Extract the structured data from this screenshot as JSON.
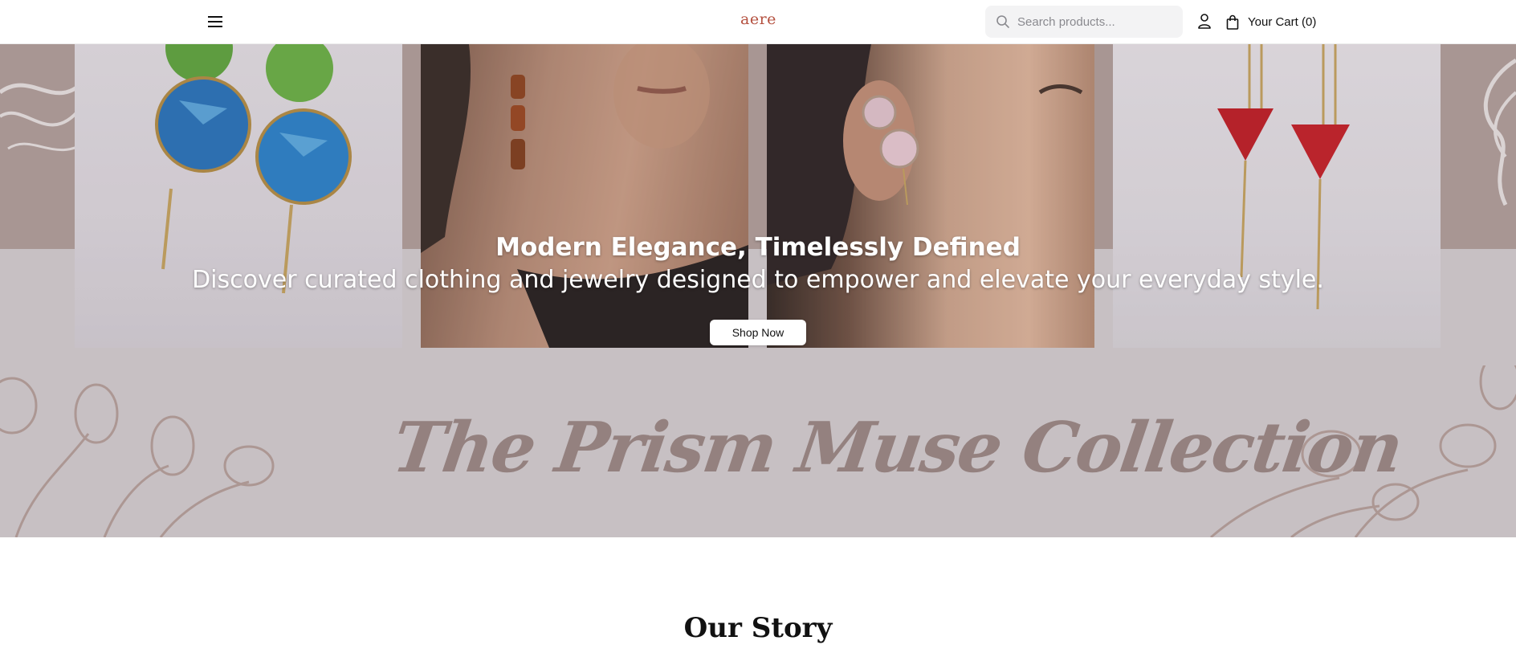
{
  "header": {
    "logo_text": "aere",
    "search_placeholder": "Search products...",
    "cart_label": "Your Cart (0)",
    "icons": {
      "menu": "hamburger-menu-icon",
      "search": "search-icon",
      "account": "user-icon",
      "cart": "shopping-bag-icon"
    }
  },
  "hero": {
    "title": "Modern Elegance, Timelessly Defined",
    "subtitle": "Discover curated clothing and jewelry designed to empower and elevate your everyday style.",
    "cta_label": "Shop Now",
    "collection_name": "The Prism Muse Collection",
    "colors": {
      "backdrop": "#b39f9c",
      "band": "#d8d2d6",
      "collection_text": "#9a8683"
    }
  },
  "story": {
    "title": "Our Story"
  },
  "brand": {
    "accent": "#b4503f"
  }
}
